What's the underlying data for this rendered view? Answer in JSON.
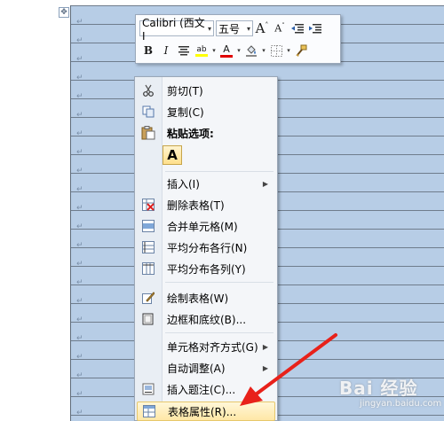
{
  "mini_toolbar": {
    "font_name": "Calibri (西文I",
    "font_size": "五号",
    "buttons_row1": [
      {
        "name": "grow-font-icon",
        "glyph": "A˄"
      },
      {
        "name": "shrink-font-icon",
        "glyph": "A˅"
      },
      {
        "name": "decrease-indent-icon",
        "glyph": "⇤"
      },
      {
        "name": "increase-indent-icon",
        "glyph": "⇥"
      }
    ],
    "bold": "B",
    "italic": "I",
    "font_color_glyph": "A",
    "highlight_glyph": "ab",
    "colors": {
      "highlight": "#ffff00",
      "font_color": "#e00000",
      "shading": "#888888"
    }
  },
  "context_menu": {
    "items": [
      {
        "id": "cut",
        "label": "剪切(T)",
        "icon": "scissors-icon"
      },
      {
        "id": "copy",
        "label": "复制(C)",
        "icon": "copy-icon"
      },
      {
        "id": "paste-options",
        "label": "粘贴选项:",
        "icon": "clipboard-icon"
      },
      {
        "id": "paste-text-only",
        "label": "A",
        "icon": "paste-text-only-icon"
      },
      {
        "id": "insert",
        "label": "插入(I)",
        "icon": ""
      },
      {
        "id": "delete-table",
        "label": "删除表格(T)",
        "icon": "delete-table-icon"
      },
      {
        "id": "merge-cells",
        "label": "合并单元格(M)",
        "icon": "merge-cells-icon"
      },
      {
        "id": "distribute-rows",
        "label": "平均分布各行(N)",
        "icon": "distribute-rows-icon"
      },
      {
        "id": "distribute-columns",
        "label": "平均分布各列(Y)",
        "icon": "distribute-columns-icon"
      },
      {
        "id": "draw-table",
        "label": "绘制表格(W)",
        "icon": "draw-table-icon"
      },
      {
        "id": "borders-shading",
        "label": "边框和底纹(B)...",
        "icon": "borders-shading-icon"
      },
      {
        "id": "cell-alignment",
        "label": "单元格对齐方式(G)",
        "icon": ""
      },
      {
        "id": "autofit",
        "label": "自动调整(A)",
        "icon": ""
      },
      {
        "id": "insert-caption",
        "label": "插入题注(C)...",
        "icon": "caption-icon"
      },
      {
        "id": "table-properties",
        "label": "表格属性(R)...",
        "icon": "table-properties-icon"
      }
    ]
  },
  "watermark": {
    "text": "Bai 经验",
    "sub": "jingyan.baidu.com"
  }
}
